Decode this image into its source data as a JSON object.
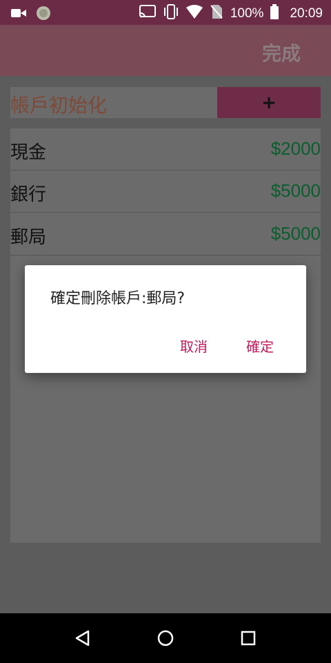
{
  "status_bar": {
    "battery_percent": "100%",
    "time": "20:09"
  },
  "app_bar": {
    "done_label": "完成"
  },
  "init_row": {
    "title": "帳戶初始化",
    "add_label": "+"
  },
  "accounts": [
    {
      "name": "現金",
      "amount": "$2000"
    },
    {
      "name": "銀行",
      "amount": "$5000"
    },
    {
      "name": "郵局",
      "amount": "$5000"
    }
  ],
  "dialog": {
    "message": "確定刪除帳戶:郵局?",
    "cancel_label": "取消",
    "ok_label": "確定"
  },
  "colors": {
    "status_bar_bg": "#6b2a45",
    "accent": "#c2185b",
    "amount_green": "#0c5e2f"
  }
}
